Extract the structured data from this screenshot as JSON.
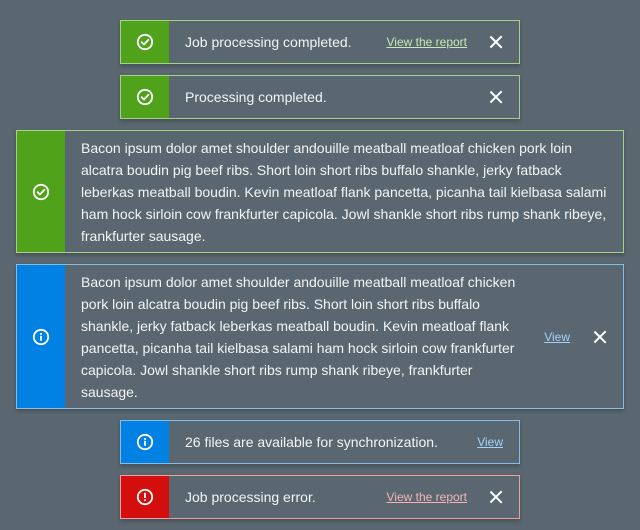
{
  "notifications": [
    {
      "type": "success",
      "icon": "check-circle-icon",
      "message": "Job processing completed.",
      "link": "View the report",
      "close_icon": "close-icon"
    },
    {
      "type": "success",
      "icon": "check-circle-icon",
      "message": "Processing completed.",
      "close_icon": "close-icon"
    },
    {
      "type": "success",
      "icon": "check-circle-icon",
      "message": "Bacon ipsum dolor amet shoulder andouille meatball meatloaf chicken pork loin alcatra boudin pig beef ribs. Short loin short ribs buffalo shankle, jerky fatback leberkas meatball boudin. Kevin meatloaf flank pancetta, picanha tail kielbasa salami ham hock sirloin cow frankfurter capicola. Jowl shankle short ribs rump shank ribeye, frankfurter sausage."
    },
    {
      "type": "info",
      "icon": "info-circle-icon",
      "message": "Bacon ipsum dolor amet shoulder andouille meatball meatloaf chicken pork loin alcatra boudin pig beef ribs. Short loin short ribs buffalo shankle, jerky fatback leberkas meatball boudin. Kevin meatloaf flank pancetta, picanha tail kielbasa salami ham hock sirloin cow frankfurter capicola. Jowl shankle short ribs rump shank ribeye, frankfurter sausage.",
      "link": "View",
      "close_icon": "close-icon"
    },
    {
      "type": "info",
      "icon": "info-circle-icon",
      "message": "26 files are available for synchronization.",
      "link": "View"
    },
    {
      "type": "error",
      "icon": "error-circle-icon",
      "message": "Job processing error.",
      "link": "View the report",
      "close_icon": "close-icon"
    }
  ],
  "colors": {
    "background": "#5a6770",
    "success": "#50a21b",
    "info": "#0081e3",
    "error": "#d40d0d"
  }
}
